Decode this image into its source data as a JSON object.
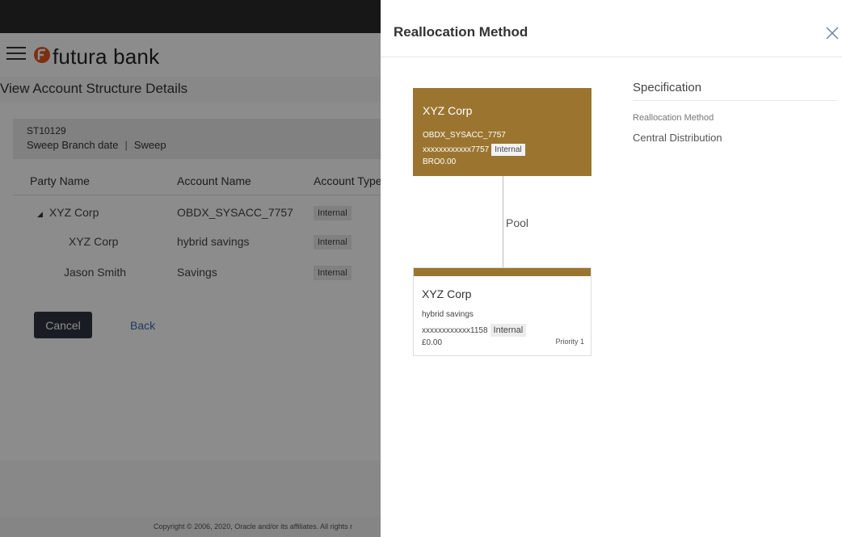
{
  "app": {
    "brand": "futura bank",
    "page_title": "View Account Structure Details"
  },
  "structure": {
    "id": "ST10129",
    "branch_date": "Sweep Branch date",
    "type": "Sweep"
  },
  "table": {
    "headers": [
      "Party Name",
      "Account Name",
      "Account Type"
    ],
    "rows": [
      {
        "party": "XYZ Corp",
        "account": "OBDX_SYSACC_7757",
        "type": "Internal"
      },
      {
        "party": "XYZ Corp",
        "account": "hybrid savings",
        "type": "Internal"
      },
      {
        "party": "Jason Smith",
        "account": "Savings",
        "type": "Internal"
      }
    ]
  },
  "actions": {
    "cancel": "Cancel",
    "back": "Back"
  },
  "footer": {
    "copyright": "Copyright © 2006, 2020, Oracle and/or its affiliates. All rights r"
  },
  "panel": {
    "title": "Reallocation Method",
    "parent": {
      "name": "XYZ Corp",
      "account": "OBDX_SYSACC_7757",
      "number": "xxxxxxxxxxxx7757",
      "badge": "Internal",
      "balance": "BRO0.00"
    },
    "link_label": "Pool",
    "child": {
      "name": "XYZ Corp",
      "account": "hybrid savings",
      "number": "xxxxxxxxxxxx1158",
      "badge": "Internal",
      "balance": "£0.00",
      "priority": "Priority 1"
    },
    "specification": {
      "title": "Specification",
      "label": "Reallocation Method",
      "value": "Central Distribution"
    }
  },
  "colors": {
    "accent": "#9b7530",
    "overlay": "rgba(0,0,0,0.45)"
  }
}
